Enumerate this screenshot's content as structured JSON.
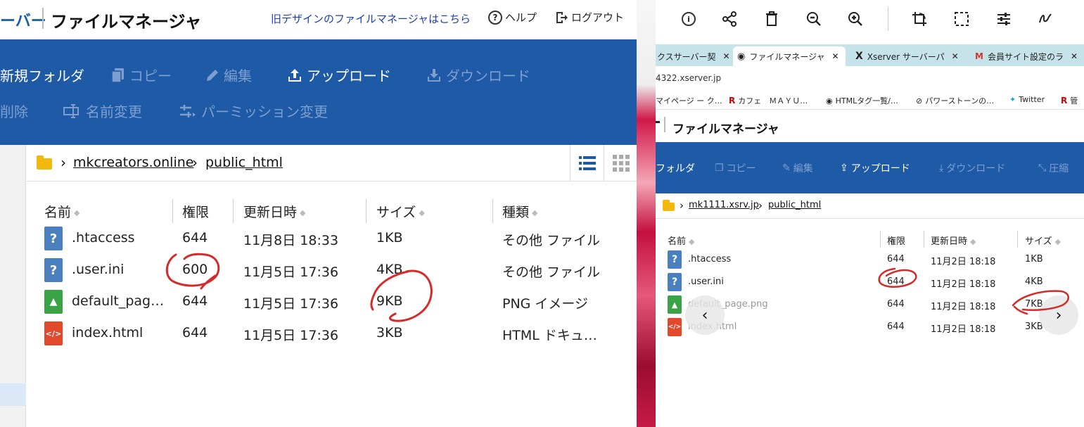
{
  "left": {
    "header": {
      "brand_tail": "ーバー",
      "title": "ファイルマネージャ",
      "old_design_link": "旧デザインのファイルマネージャはこちら",
      "help": "ヘルプ",
      "logout": "ログアウト"
    },
    "toolbar": {
      "new_folder": "新規フォルダ",
      "copy": "コピー",
      "edit": "編集",
      "upload": "アップロード",
      "download": "ダウンロード",
      "delete": "削除",
      "rename": "名前変更",
      "permission": "パーミッション変更"
    },
    "breadcrumb": {
      "domain": "mkcreators.online",
      "folder": "public_html"
    },
    "columns": {
      "name": "名前",
      "perm": "権限",
      "date": "更新日時",
      "size": "サイズ",
      "type": "種類"
    },
    "files": [
      {
        "name": ".htaccess",
        "perm": "644",
        "date": "11月8日 18:33",
        "size": "1KB",
        "type": "その他 ファイル",
        "icon": "question-file-icon"
      },
      {
        "name": ".user.ini",
        "perm": "600",
        "date": "11月5日 17:36",
        "size": "4KB",
        "type": "その他 ファイル",
        "icon": "question-file-icon"
      },
      {
        "name": "default_pag…",
        "perm": "644",
        "date": "11月5日 17:36",
        "size": "9KB",
        "type": "PNG イメージ",
        "icon": "image-file-icon"
      },
      {
        "name": "index.html",
        "perm": "644",
        "date": "11月5日 17:36",
        "size": "3KB",
        "type": "HTML ドキュ…",
        "icon": "html-file-icon"
      }
    ]
  },
  "right": {
    "tabs": [
      {
        "label": "クスサーバー契"
      },
      {
        "label": "ファイルマネージャ"
      },
      {
        "label": "Xserver サーバーパ"
      },
      {
        "label": "会員サイト設定のラ"
      }
    ],
    "url": "4322.xserver.jp",
    "bookmarks": [
      "マイページ ー ク…",
      "カフェ　ＭＡＹＵ…",
      "HTMLタグ一覧/…",
      "パワーストーンの…",
      "Twitter",
      "管"
    ],
    "header_title": "ファイルマネージャ",
    "toolbar": {
      "folder": "フォルダ",
      "copy": "コピー",
      "edit": "編集",
      "upload": "アップロード",
      "download": "ダウンロード",
      "compress": "圧縮"
    },
    "breadcrumb": {
      "domain": "mk1111.xsrv.jp",
      "folder": "public_html"
    },
    "columns": {
      "name": "名前",
      "perm": "権限",
      "date": "更新日時",
      "size": "サイズ"
    },
    "files": [
      {
        "name": ".htaccess",
        "perm": "644",
        "date": "11月2日 18:18",
        "size": "1KB"
      },
      {
        "name": ".user.ini",
        "perm": "644",
        "date": "11月2日 18:18",
        "size": "4KB"
      },
      {
        "name": "default_page.png",
        "perm": "644",
        "date": "11月2日 18:18",
        "size": "7KB"
      },
      {
        "name": "index.html",
        "perm": "644",
        "date": "11月2日 18:18",
        "size": "3KB"
      }
    ]
  },
  "colors": {
    "toolbar_blue": "#1e5aa6",
    "annotation_red": "#d42a2a",
    "link_blue": "#1a3fb0"
  }
}
